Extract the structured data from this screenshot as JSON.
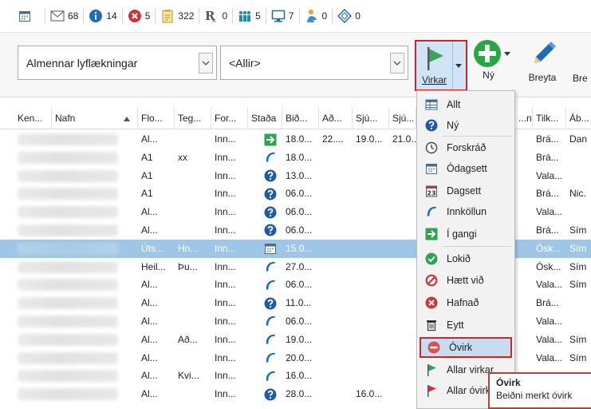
{
  "status_bar": [
    {
      "icon": "calendar-icon",
      "count": ""
    },
    {
      "icon": "envelope-icon",
      "count": "68"
    },
    {
      "icon": "info-icon",
      "count": "14"
    },
    {
      "icon": "error-icon",
      "count": "5"
    },
    {
      "icon": "clipboard-icon",
      "count": "322"
    },
    {
      "icon": "prescription-icon",
      "count": "0"
    },
    {
      "icon": "people-icon",
      "count": "5"
    },
    {
      "icon": "monitor-icon",
      "count": "7"
    },
    {
      "icon": "person-icon",
      "count": "0"
    },
    {
      "icon": "diamond-icon",
      "count": "0"
    }
  ],
  "toolbar": {
    "department": "Almennar lyflækningar",
    "filter": "<Allir>",
    "virkar_label": "Virkar",
    "new_label": "Ný",
    "edit_label": "Breyta",
    "more_label": "Bre"
  },
  "columns": [
    "Ken...",
    "Nafn",
    "Flo...",
    "Teg...",
    "For...",
    "Staða",
    "Bið...",
    "Að...",
    "Sjú...",
    "Sjú...",
    "...",
    "...n...",
    "Tilk...",
    "Áb..."
  ],
  "rows": [
    {
      "c1": "Al...",
      "c2": "",
      "c3": "Inn...",
      "icon": "arrow-right-icon",
      "c5": "18.0...",
      "c6": "22....",
      "c7": "19.0...",
      "c8": "21.0...",
      "c9": "Brá...",
      "c10": "Dan"
    },
    {
      "c1": "A1",
      "c2": "xx",
      "c3": "Inn...",
      "icon": "phone-icon",
      "c5": "18.0...",
      "c6": "",
      "c7": "",
      "c8": "",
      "c9": "Brá...",
      "c10": ""
    },
    {
      "c1": "A1",
      "c2": "",
      "c3": "Inn...",
      "icon": "question-icon",
      "c5": "13.0...",
      "c6": "",
      "c7": "",
      "c8": "",
      "c9": "Vala...",
      "c10": ""
    },
    {
      "c1": "A1",
      "c2": "",
      "c3": "Inn...",
      "icon": "question-icon",
      "c5": "06.0...",
      "c6": "",
      "c7": "",
      "c8": "",
      "c9": "Brá...",
      "c10": "Nic."
    },
    {
      "c1": "Al...",
      "c2": "",
      "c3": "Inn...",
      "icon": "question-icon",
      "c5": "06.0...",
      "c6": "",
      "c7": "",
      "c8": "",
      "c9": "Vala...",
      "c10": ""
    },
    {
      "c1": "Al...",
      "c2": "",
      "c3": "Inn...",
      "icon": "question-icon",
      "c5": "06.0...",
      "c6": "",
      "c7": "",
      "c8": "",
      "c9": "Brá...",
      "c10": "Sím"
    },
    {
      "c1": "Úts...",
      "c2": "Hn...",
      "c3": "Inn...",
      "icon": "calendar-icon",
      "c5": "15.0...",
      "c6": "",
      "c7": "",
      "c8": "",
      "c9": "Ósk...",
      "c10": "Sím",
      "selected": true
    },
    {
      "c1": "Heil...",
      "c2": "Þu...",
      "c3": "Inn...",
      "icon": "phone-icon",
      "c5": "27.0...",
      "c6": "",
      "c7": "",
      "c8": "",
      "c9": "Ósk...",
      "c10": "Sím"
    },
    {
      "c1": "Al...",
      "c2": "",
      "c3": "Inn...",
      "icon": "phone-icon",
      "c5": "06.0...",
      "c6": "",
      "c7": "",
      "c8": "",
      "c9": "Vala...",
      "c10": "Sím"
    },
    {
      "c1": "Al...",
      "c2": "",
      "c3": "Inn...",
      "icon": "question-icon",
      "c5": "11.0...",
      "c6": "",
      "c7": "",
      "c8": "",
      "c9": "Brá...",
      "c10": ""
    },
    {
      "c1": "Al...",
      "c2": "",
      "c3": "Inn...",
      "icon": "phone-icon",
      "c5": "06.0...",
      "c6": "",
      "c7": "",
      "c8": "",
      "c9": "Vala...",
      "c10": ""
    },
    {
      "c1": "Al...",
      "c2": "Að...",
      "c3": "Inn...",
      "icon": "phone-icon",
      "c5": "19.0...",
      "c6": "",
      "c7": "",
      "c8": "",
      "c9": "Vala...",
      "c10": "Sím"
    },
    {
      "c1": "Al...",
      "c2": "",
      "c3": "Inn...",
      "icon": "phone-icon",
      "c5": "20.0...",
      "c6": "",
      "c7": "",
      "c8": "",
      "c9": "Vala...",
      "c10": "Sím"
    },
    {
      "c1": "Al...",
      "c2": "Kvi...",
      "c3": "Inn...",
      "icon": "phone-icon",
      "c5": "16.0...",
      "c6": "",
      "c7": "",
      "c8": "",
      "c9": "",
      "c10": ""
    },
    {
      "c1": "Al...",
      "c2": "",
      "c3": "Inn...",
      "icon": "question-icon",
      "c5": "28.0...",
      "c6": "",
      "c7": "16.0...",
      "c8": "",
      "c9": "",
      "c10": ""
    }
  ],
  "menu": [
    {
      "label": "Allt",
      "icon": "table-icon"
    },
    {
      "label": "Ný",
      "icon": "question-icon"
    },
    {
      "label": "Forskráð",
      "icon": "clock-icon"
    },
    {
      "label": "Ódagsett",
      "icon": "calendar-icon"
    },
    {
      "label": "Dagsett",
      "icon": "calendar-23-icon"
    },
    {
      "label": "Innköllun",
      "icon": "phone-icon"
    },
    {
      "label": "Í gangi",
      "icon": "arrow-right-icon"
    },
    {
      "label": "Lokið",
      "icon": "check-icon"
    },
    {
      "label": "Hætt við",
      "icon": "cancel-icon"
    },
    {
      "label": "Hafnað",
      "icon": "rejected-icon"
    },
    {
      "label": "Eytt",
      "icon": "trash-icon"
    },
    {
      "label": "Óvirk",
      "icon": "inactive-icon"
    },
    {
      "label": "Allar virkar",
      "icon": "green-flag-icon"
    },
    {
      "label": "Allar óvirkar",
      "icon": "red-flag-icon"
    }
  ],
  "tooltip": {
    "title": "Óvirk",
    "text": "Beiðni merkt óvirk"
  }
}
